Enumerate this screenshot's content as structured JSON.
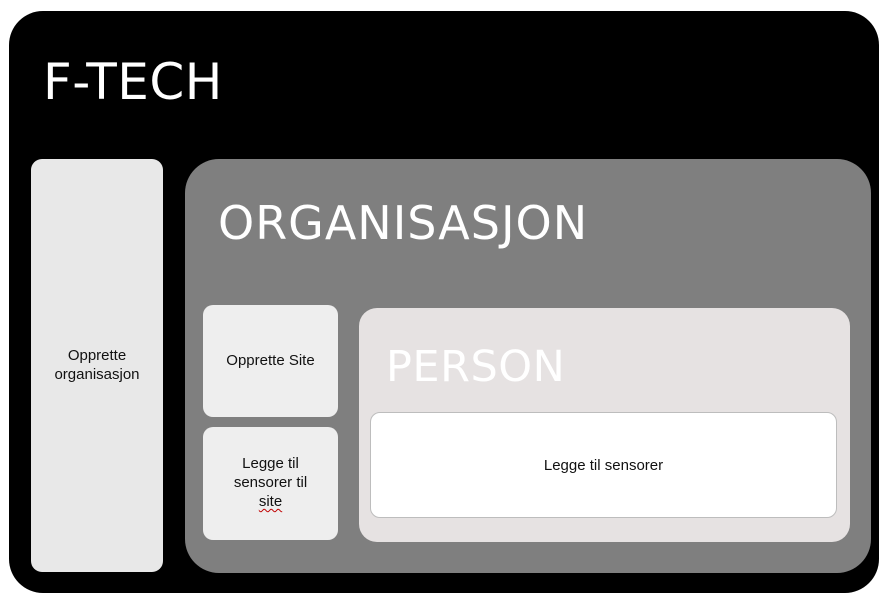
{
  "frame": {
    "title": "F-TECH"
  },
  "left_panel": {
    "label_line1": "Opprette",
    "label_line2": "organisasjon"
  },
  "organisation": {
    "title": "ORGANISASJON",
    "create_site_label": "Opprette Site",
    "add_sensors_line1": "Legge til",
    "add_sensors_line2": "sensorer til",
    "add_sensors_line3": "site"
  },
  "person": {
    "title": "PERSON",
    "add_sensors_label": "Legge til sensorer"
  },
  "colors": {
    "frame_background": "#000000",
    "organisation_background": "#7f7f7f",
    "person_background": "#e6e2e2",
    "button_background": "#eeeeee",
    "title_text": "#ffffff"
  }
}
